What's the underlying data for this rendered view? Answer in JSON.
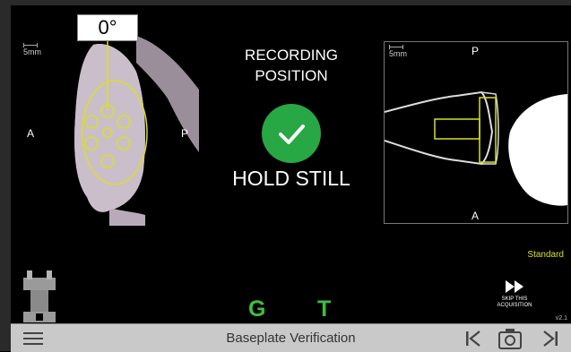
{
  "left_view": {
    "scale_label": "5mm",
    "angle": "0°",
    "anterior_label": "A",
    "posterior_label": "P"
  },
  "status": {
    "title_line1": "RECORDING",
    "title_line2": "POSITION",
    "instruction": "HOLD STILL"
  },
  "right_view": {
    "scale_label": "5mm",
    "top_label": "P",
    "bottom_label": "A"
  },
  "standard_label": "Standard",
  "skip": {
    "line1": "SKIP THIS",
    "line2": "ACQUISITION"
  },
  "version": "v2.1",
  "indicators": {
    "g": "G",
    "t": "T"
  },
  "colors": {
    "accent_green": "#28a745",
    "indicator_green": "#3fbf3f",
    "implant_yellow": "#d9e021",
    "bottom_bar": "#c9c9c9"
  },
  "bottom_bar": {
    "title": "Baseplate Verification",
    "icons": [
      "menu-icon",
      "skip-back-icon",
      "camera-icon",
      "skip-forward-icon"
    ]
  }
}
